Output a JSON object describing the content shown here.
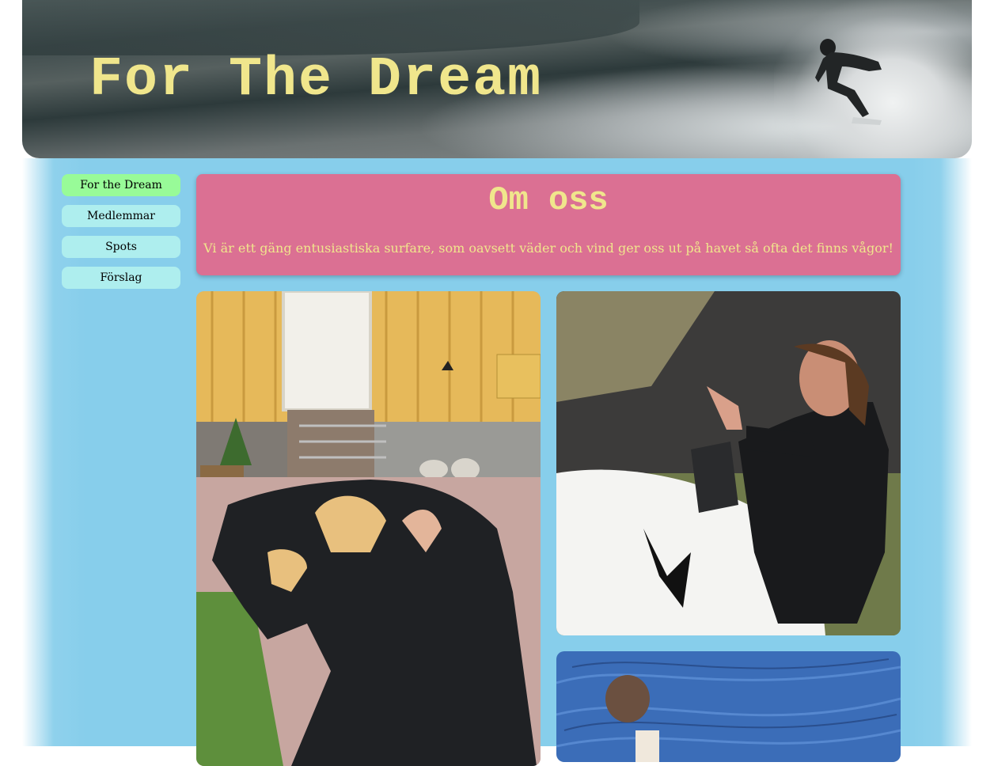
{
  "header": {
    "title": "For The Dream"
  },
  "nav": {
    "items": [
      {
        "label": "For the Dream",
        "active": true
      },
      {
        "label": "Medlemmar",
        "active": false
      },
      {
        "label": "Spots",
        "active": false
      },
      {
        "label": "Förslag",
        "active": false
      }
    ]
  },
  "about": {
    "heading": "Om oss",
    "text": "Vi är ett gäng entusiastiska surfare, som oavsett väder och vind ger oss ut på havet så ofta det finns vågor!"
  },
  "colors": {
    "title": "#f0e68c",
    "nav_bg": "#aeeeee",
    "nav_active_bg": "#98fb98",
    "about_bg": "#db7093",
    "page_bg": "#87ceeb"
  }
}
